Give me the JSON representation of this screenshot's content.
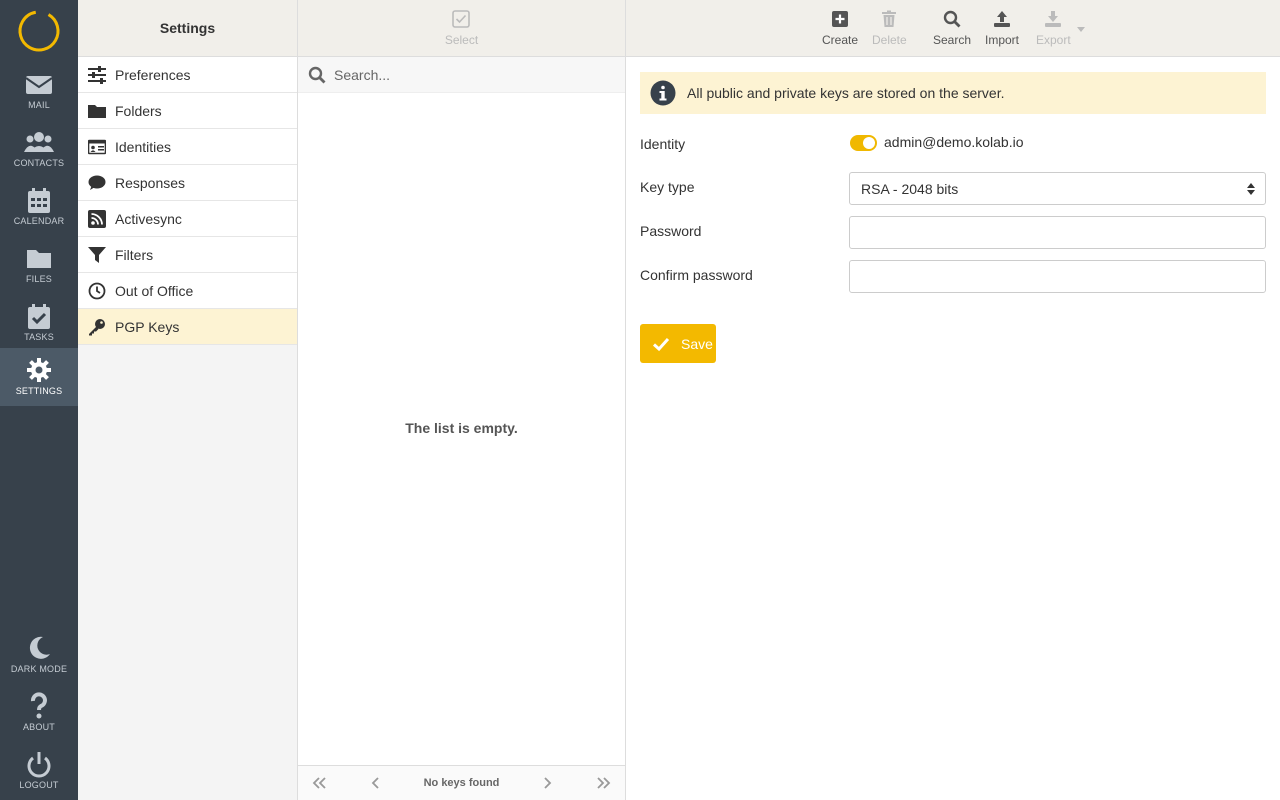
{
  "nav": {
    "items": [
      {
        "label": "MAIL",
        "icon": "mail-icon"
      },
      {
        "label": "CONTACTS",
        "icon": "contacts-icon"
      },
      {
        "label": "CALENDAR",
        "icon": "calendar-icon"
      },
      {
        "label": "FILES",
        "icon": "folder-icon"
      },
      {
        "label": "TASKS",
        "icon": "tasks-icon"
      },
      {
        "label": "SETTINGS",
        "icon": "gear-icon",
        "active": true
      },
      {
        "label": "DARK MODE",
        "icon": "moon-icon"
      },
      {
        "label": "ABOUT",
        "icon": "question-icon"
      },
      {
        "label": "LOGOUT",
        "icon": "power-icon"
      }
    ],
    "accent": "#f3b900"
  },
  "settings": {
    "title": "Settings",
    "items": [
      {
        "label": "Preferences",
        "icon": "sliders-icon"
      },
      {
        "label": "Folders",
        "icon": "folder-icon"
      },
      {
        "label": "Identities",
        "icon": "id-card-icon"
      },
      {
        "label": "Responses",
        "icon": "comment-icon"
      },
      {
        "label": "Activesync",
        "icon": "rss-icon"
      },
      {
        "label": "Filters",
        "icon": "filter-icon"
      },
      {
        "label": "Out of Office",
        "icon": "clock-icon"
      },
      {
        "label": "PGP Keys",
        "icon": "key-icon",
        "active": true
      }
    ]
  },
  "list": {
    "select_label": "Select",
    "search_placeholder": "Search...",
    "empty_text": "The list is empty.",
    "pager_count": "No keys found"
  },
  "toolbar": {
    "create": "Create",
    "delete": "Delete",
    "search": "Search",
    "import": "Import",
    "export": "Export"
  },
  "form": {
    "notice": "All public and private keys are stored on the server.",
    "identity_label": "Identity",
    "identity_value": "admin@demo.kolab.io",
    "identity_enabled": true,
    "keytype_label": "Key type",
    "keytype_value": "RSA - 2048 bits",
    "password_label": "Password",
    "password_value": "",
    "confirm_label": "Confirm password",
    "confirm_value": "",
    "save_label": "Save"
  }
}
